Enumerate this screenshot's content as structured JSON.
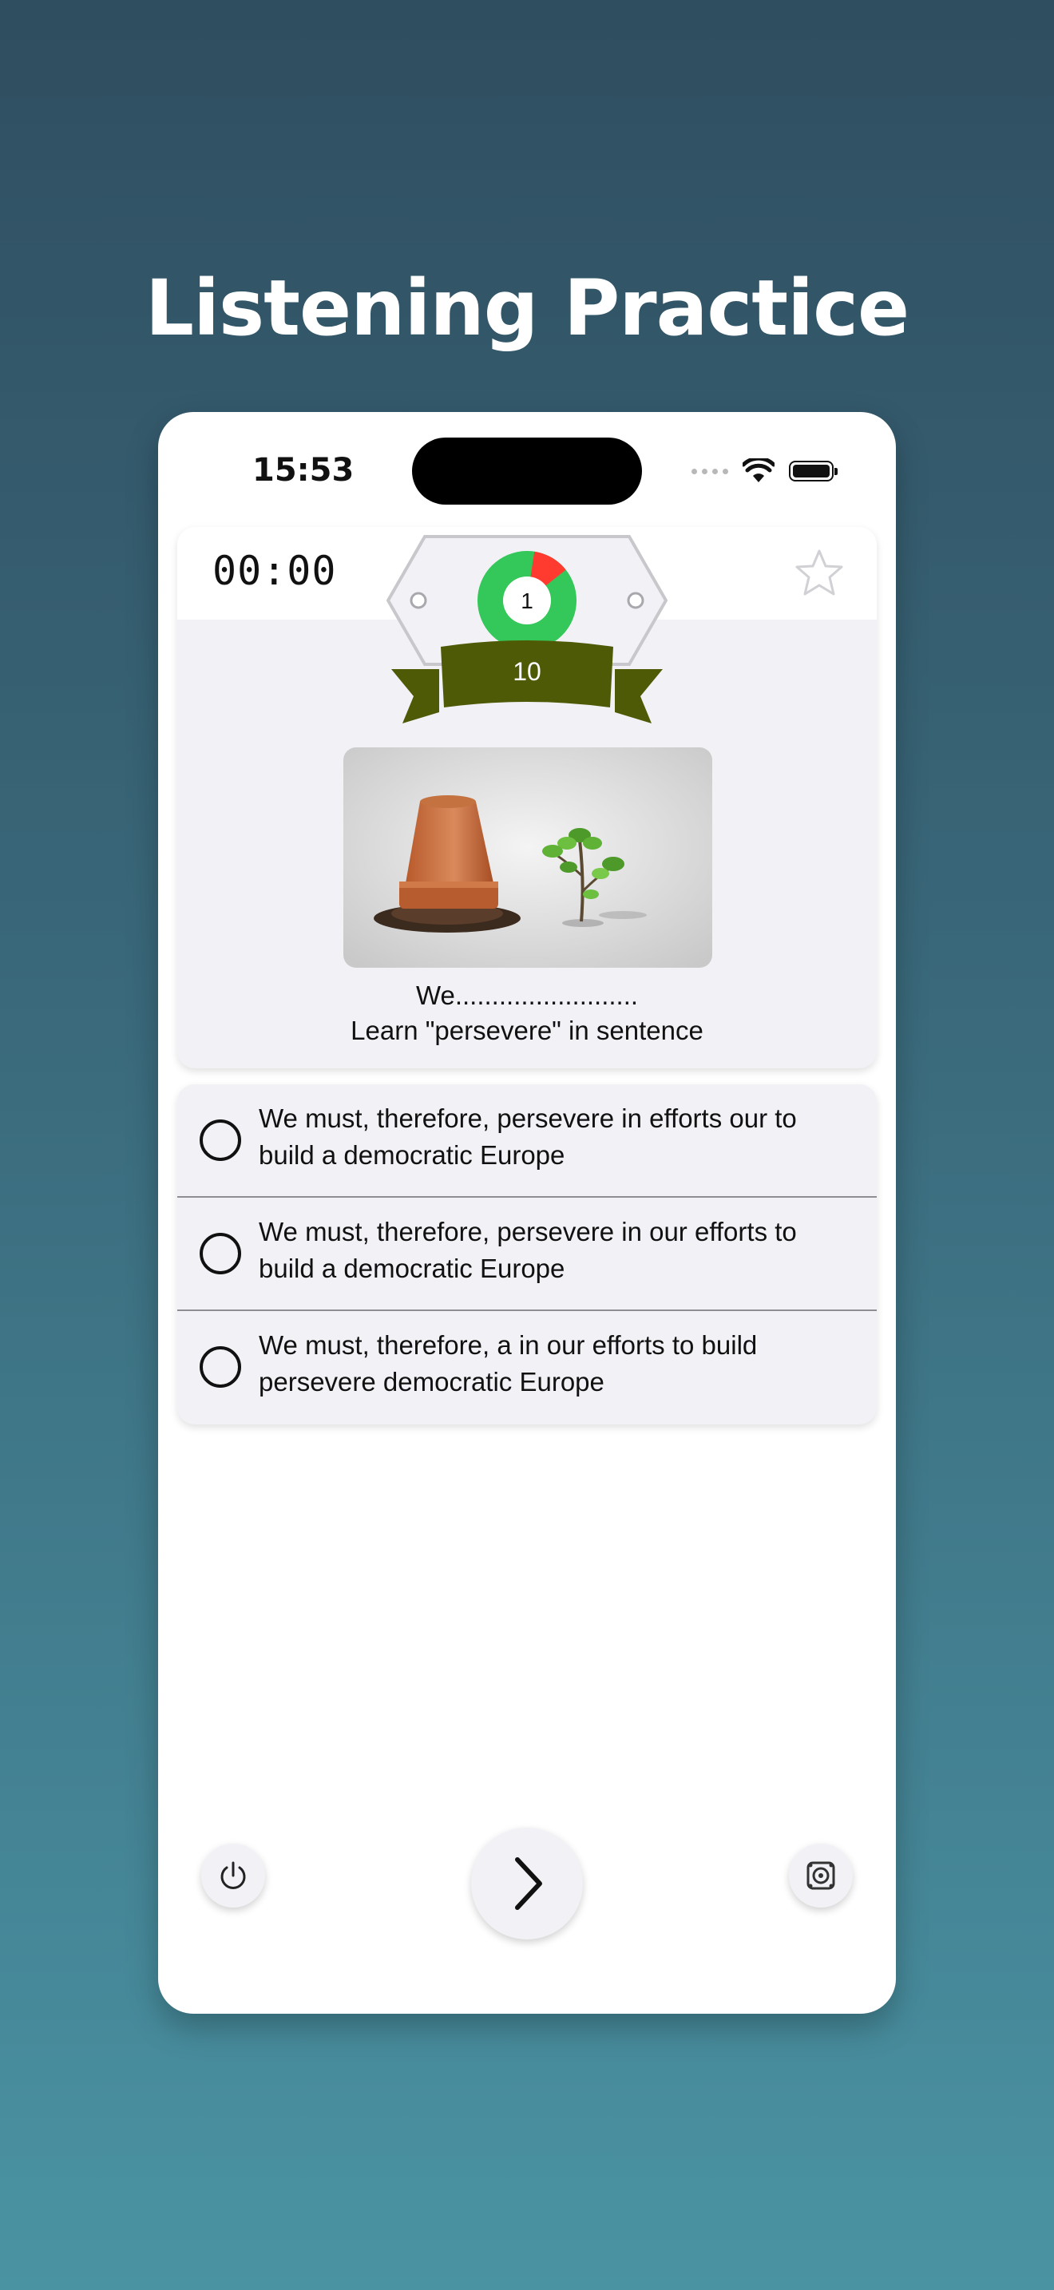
{
  "page": {
    "title": "Listening Practice"
  },
  "status_bar": {
    "time": "15:53"
  },
  "quiz": {
    "timer": "00:00",
    "badge": {
      "level": "1",
      "score": "10",
      "progress_fraction": 0.12
    },
    "image_alt": "Overturned clay flower pot beside a small sprouting tree",
    "prompt_line1": "We.........................",
    "prompt_line2": "Learn \"persevere\" in sentence"
  },
  "options": [
    {
      "text": "We must, therefore, persevere in efforts our to build a democratic Europe"
    },
    {
      "text": "We must, therefore, persevere in our efforts to build a democratic Europe"
    },
    {
      "text": "We must, therefore, a in our efforts to build persevere democratic Europe"
    }
  ],
  "controls": {
    "power_icon": "power-icon",
    "next_icon": "chevron-right-icon",
    "speaker_icon": "speaker-icon"
  },
  "colors": {
    "badge_ring": "#34c759",
    "badge_progress": "#ff3b30",
    "ribbon": "#4f5a06",
    "card_bg": "#f2f1f6"
  }
}
